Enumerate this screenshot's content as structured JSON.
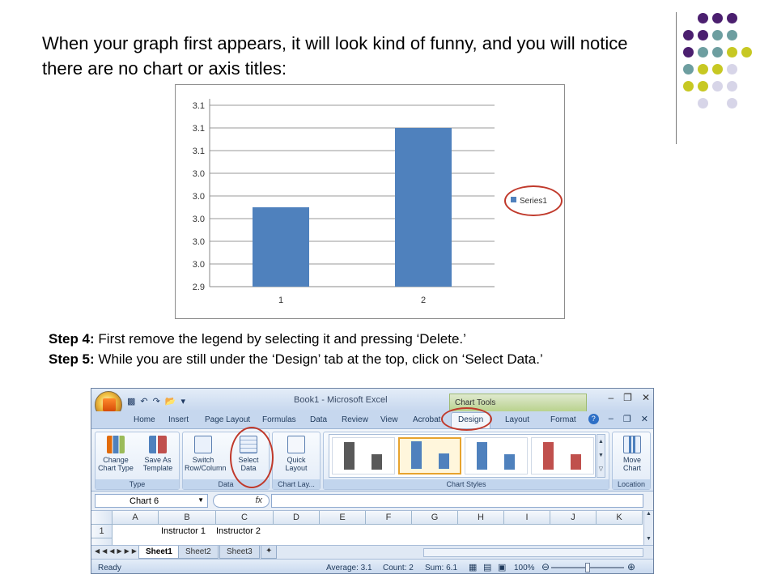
{
  "intro_text": "When your graph first appears, it will look kind of funny, and you will notice there are no chart or axis titles:",
  "chart_data": {
    "type": "bar",
    "categories": [
      "1",
      "2"
    ],
    "series": [
      {
        "name": "Series1",
        "values": [
          3.0,
          3.1
        ],
        "color": "#4f81bd"
      }
    ],
    "y_tick_labels": [
      "2.9",
      "3.0",
      "3.0",
      "3.0",
      "3.0",
      "3.0",
      "3.1",
      "3.1",
      "3.1"
    ],
    "ylim": [
      2.9,
      3.15
    ],
    "title": "",
    "xlabel": "",
    "ylabel": "",
    "grid": true,
    "legend": "right"
  },
  "steps": {
    "step4_label": "Step 4:",
    "step4_text": " First remove the legend by selecting it and pressing ‘Delete.’",
    "step5_label": "Step 5:",
    "step5_text": " While you are still under the ‘Design’ tab at the top, click on ‘Select Data.’"
  },
  "excel": {
    "window_title": "Book1 - Microsoft Excel",
    "context_tab": "Chart Tools",
    "tabs": [
      "Home",
      "Insert",
      "Page Layout",
      "Formulas",
      "Data",
      "Review",
      "View",
      "Acrobat",
      "Design",
      "Layout",
      "Format"
    ],
    "ribbon": {
      "change_chart_type": "Change Chart Type",
      "save_as_template": "Save As Template",
      "group_type": "Type",
      "switch_row_column": "Switch Row/Column",
      "select_data": "Select Data",
      "group_data": "Data",
      "quick_layout": "Quick Layout",
      "group_chart_layouts": "Chart Lay...",
      "group_chart_styles": "Chart Styles",
      "move_chart": "Move Chart",
      "group_location": "Location"
    },
    "name_box": "Chart 6",
    "fx_symbol": "fx",
    "columns": [
      "A",
      "B",
      "C",
      "D",
      "E",
      "F",
      "G",
      "H",
      "I",
      "J",
      "K"
    ],
    "row1": {
      "num": "1",
      "B": "Instructor 1",
      "C": "Instructor 2"
    },
    "sheet_tabs": [
      "Sheet1",
      "Sheet2",
      "Sheet3"
    ],
    "status": {
      "ready": "Ready",
      "average": "Average: 3.1",
      "count": "Count: 2",
      "sum": "Sum: 6.1",
      "zoom": "100%"
    },
    "colors": {
      "accent": "#4f81bd",
      "highlight_ring": "#c0392b",
      "dot_purple": "#4b1f6f",
      "dot_teal": "#6d9ea0",
      "dot_yellow": "#c7c823",
      "dot_lavender": "#d7d5e8"
    }
  }
}
